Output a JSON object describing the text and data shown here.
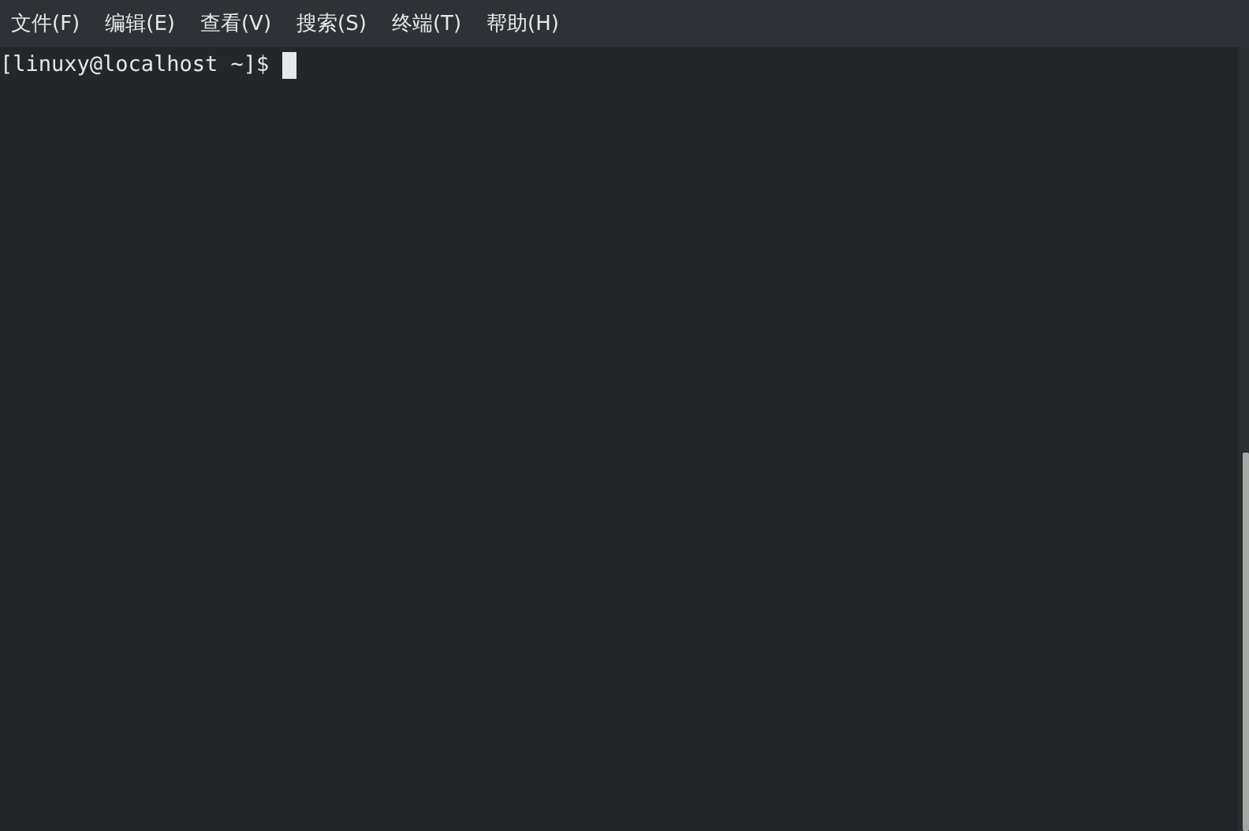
{
  "menu_bar": {
    "items": [
      {
        "label": "文件(F)"
      },
      {
        "label": "编辑(E)"
      },
      {
        "label": "查看(V)"
      },
      {
        "label": "搜索(S)"
      },
      {
        "label": "终端(T)"
      },
      {
        "label": "帮助(H)"
      }
    ]
  },
  "terminal": {
    "lines": [
      "[linuxy@localhost ~]$ "
    ]
  }
}
